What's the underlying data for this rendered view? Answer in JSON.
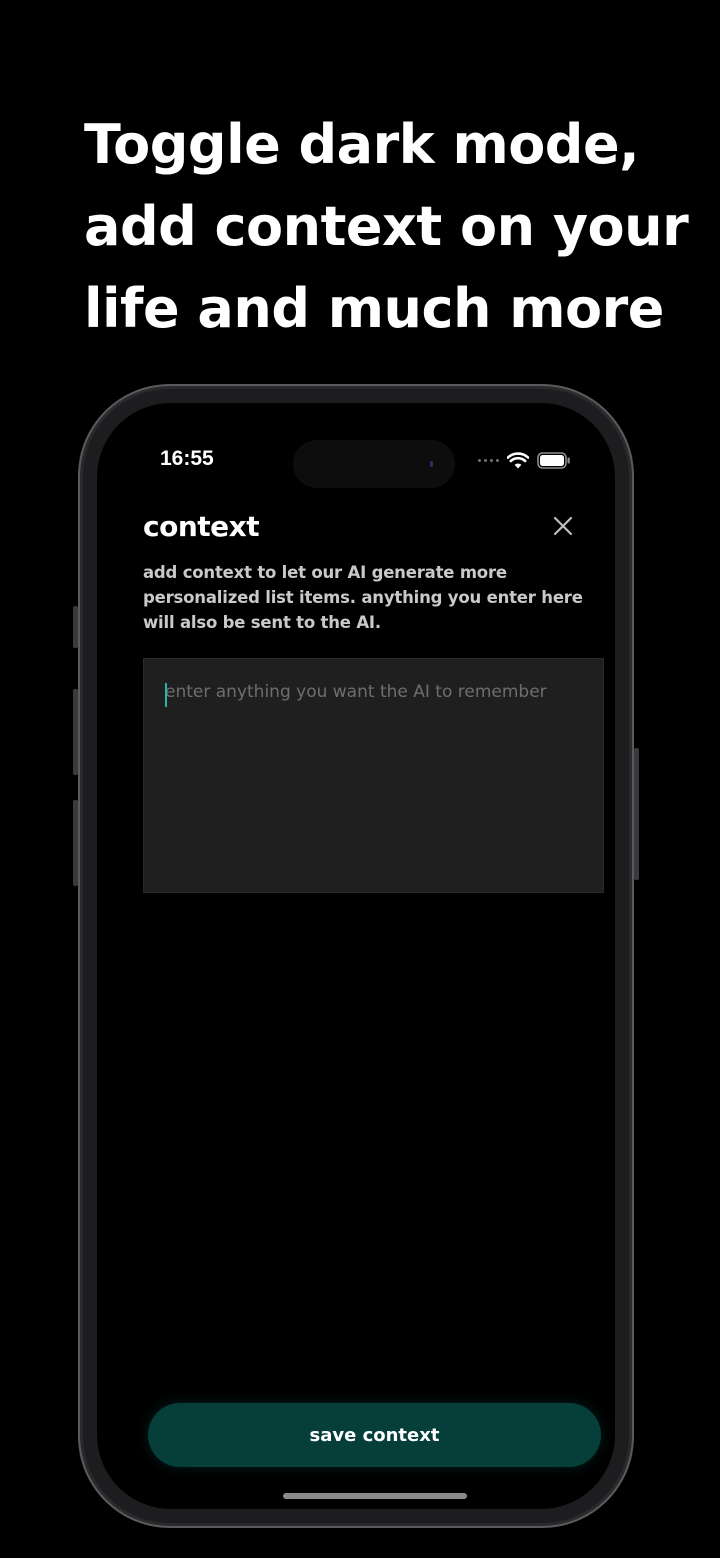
{
  "headline": {
    "line1": "Toggle dark mode,",
    "line2": "add context on your",
    "line3": "life and much more"
  },
  "status_bar": {
    "time": "16:55",
    "icons": [
      "signal-icon",
      "wifi-icon",
      "battery-icon"
    ]
  },
  "context_screen": {
    "title": "context",
    "close_icon": "close-icon",
    "description": "add context to let our AI generate more personalized list items. anything you enter here will also be sent to the AI.",
    "input": {
      "value": "",
      "placeholder": "enter anything you want the AI to remember"
    },
    "save_label": "save context"
  },
  "colors": {
    "background": "#000000",
    "input_background": "#1f1f1f",
    "accent_button": "#063f3a",
    "cursor": "#2bb3a8"
  }
}
